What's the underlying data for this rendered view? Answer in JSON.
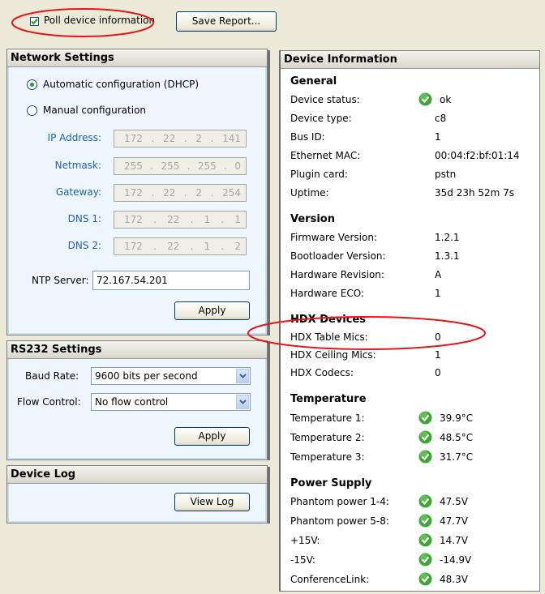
{
  "toolbar": {
    "poll_label": "Poll device information",
    "poll_checked": true,
    "save_report_label": "Save Report..."
  },
  "network": {
    "title": "Network Settings",
    "dhcp_label": "Automatic configuration (DHCP)",
    "manual_label": "Manual configuration",
    "mode": "dhcp",
    "fields": [
      {
        "label": "IP Address:",
        "octets": [
          "172",
          "22",
          "2",
          "141"
        ]
      },
      {
        "label": "Netmask:",
        "octets": [
          "255",
          "255",
          "255",
          "0"
        ]
      },
      {
        "label": "Gateway:",
        "octets": [
          "172",
          "22",
          "2",
          "254"
        ]
      },
      {
        "label": "DNS 1:",
        "octets": [
          "172",
          "22",
          "1",
          "1"
        ]
      },
      {
        "label": "DNS 2:",
        "octets": [
          "172",
          "22",
          "1",
          "2"
        ]
      }
    ],
    "ntp_label": "NTP Server:",
    "ntp_value": "72.167.54.201",
    "apply_label": "Apply"
  },
  "rs232": {
    "title": "RS232 Settings",
    "baud_label": "Baud Rate:",
    "baud_value": "9600 bits per second",
    "flow_label": "Flow Control:",
    "flow_value": "No flow control",
    "apply_label": "Apply"
  },
  "device_log": {
    "title": "Device Log",
    "view_label": "View Log"
  },
  "device_info": {
    "title": "Device Information",
    "general": {
      "title": "General",
      "rows": [
        {
          "label": "Device status:",
          "value": "ok",
          "icon": "check-icon"
        },
        {
          "label": "Device type:",
          "value": "c8"
        },
        {
          "label": "Bus ID:",
          "value": "1"
        },
        {
          "label": "Ethernet MAC:",
          "value": "00:04:f2:bf:01:14"
        },
        {
          "label": "Plugin card:",
          "value": "pstn"
        },
        {
          "label": "Uptime:",
          "value": "35d 23h 52m 7s"
        }
      ]
    },
    "version": {
      "title": "Version",
      "rows": [
        {
          "label": "Firmware Version:",
          "value": "1.2.1"
        },
        {
          "label": "Bootloader Version:",
          "value": "1.3.1"
        },
        {
          "label": "Hardware Revision:",
          "value": "A"
        },
        {
          "label": "Hardware ECO:",
          "value": "1"
        }
      ]
    },
    "hdx": {
      "title": "HDX Devices",
      "rows": [
        {
          "label": "HDX Table Mics:",
          "value": "0"
        },
        {
          "label": "HDX Ceiling Mics:",
          "value": "1"
        },
        {
          "label": "HDX Codecs:",
          "value": "0"
        }
      ]
    },
    "temperature": {
      "title": "Temperature",
      "rows": [
        {
          "label": "Temperature 1:",
          "value": "39.9°C",
          "icon": "check-icon"
        },
        {
          "label": "Temperature 2:",
          "value": "48.5°C",
          "icon": "check-icon"
        },
        {
          "label": "Temperature 3:",
          "value": "31.7°C",
          "icon": "check-icon"
        }
      ]
    },
    "power": {
      "title": "Power Supply",
      "rows": [
        {
          "label": "Phantom power 1-4:",
          "value": "47.5V",
          "icon": "check-icon"
        },
        {
          "label": "Phantom power 5-8:",
          "value": "47.7V",
          "icon": "check-icon"
        },
        {
          "label": "+15V:",
          "value": "14.7V",
          "icon": "check-icon"
        },
        {
          "label": "-15V:",
          "value": "-14.9V",
          "icon": "check-icon"
        },
        {
          "label": "ConferenceLink:",
          "value": "48.3V",
          "icon": "check-icon"
        }
      ]
    }
  },
  "colors": {
    "annotation": "#e3161c",
    "ok_green": "#3fa535",
    "label_blue": "#1d5fb3"
  }
}
